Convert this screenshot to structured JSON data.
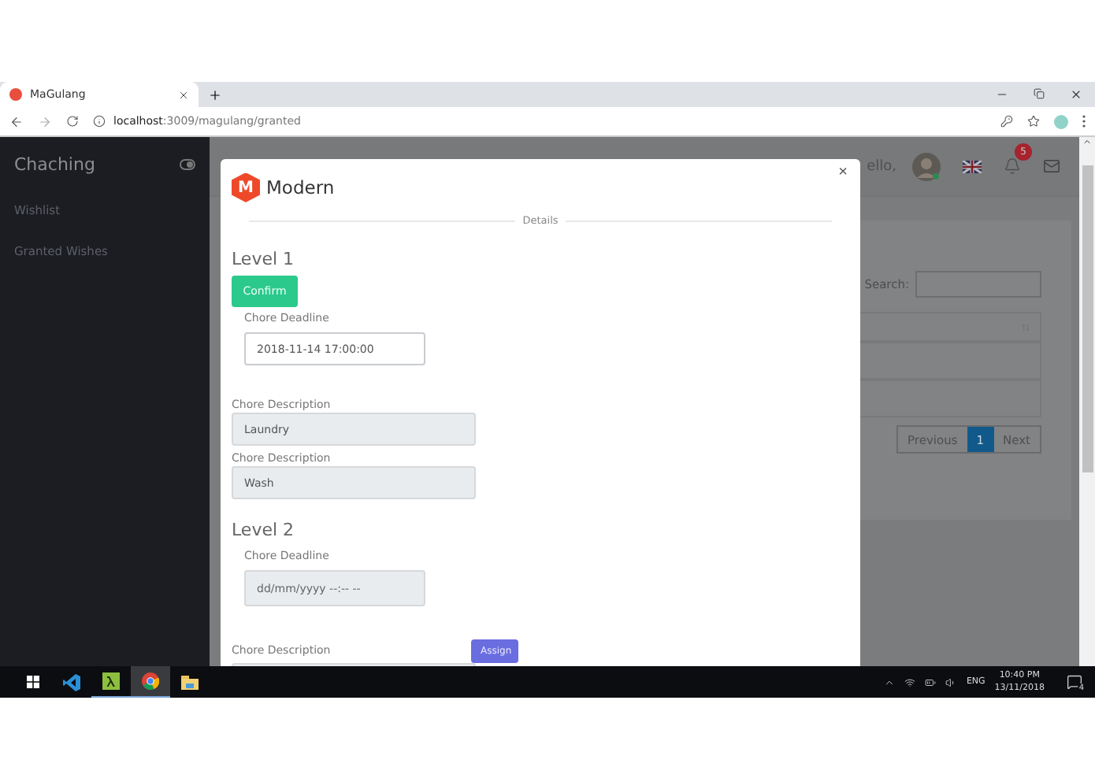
{
  "browser": {
    "tab_title": "MaGulang",
    "url_host": "localhost",
    "url_path": ":3009/magulang/granted"
  },
  "sidebar": {
    "brand": "Chaching",
    "items": [
      {
        "label": "Wishlist"
      },
      {
        "label": "Granted Wishes"
      }
    ]
  },
  "header": {
    "greeting": "ello,",
    "notification_count": "5"
  },
  "table": {
    "search_label": "Search:",
    "pagination": [
      {
        "label": "Previous",
        "selected": false
      },
      {
        "label": "1",
        "selected": true
      },
      {
        "label": "Next",
        "selected": false
      }
    ]
  },
  "modal": {
    "brand_letter": "M",
    "title": "Modern",
    "divider_label": "Details",
    "close": "×",
    "levels": [
      {
        "title": "Level 1",
        "confirm_button": "Confirm",
        "deadline": {
          "label": "Chore Deadline",
          "value": "2018-11-14 17:00:00",
          "disabled": false
        },
        "descriptions": [
          {
            "label": "Chore Description",
            "value": "Laundry",
            "disabled": true
          },
          {
            "label": "Chore Description",
            "value": "Wash",
            "disabled": true
          }
        ]
      },
      {
        "title": "Level 2",
        "deadline": {
          "label": "Chore Deadline",
          "placeholder": "dd/mm/yyyy --:-- --",
          "disabled": true
        },
        "descriptions": [
          {
            "label": "Chore Description",
            "disabled": true
          }
        ],
        "assign_button": "Assign"
      }
    ]
  },
  "taskbar": {
    "language": "ENG",
    "time": "10:40 PM",
    "date": "13/11/2018",
    "notification_count": "4"
  }
}
